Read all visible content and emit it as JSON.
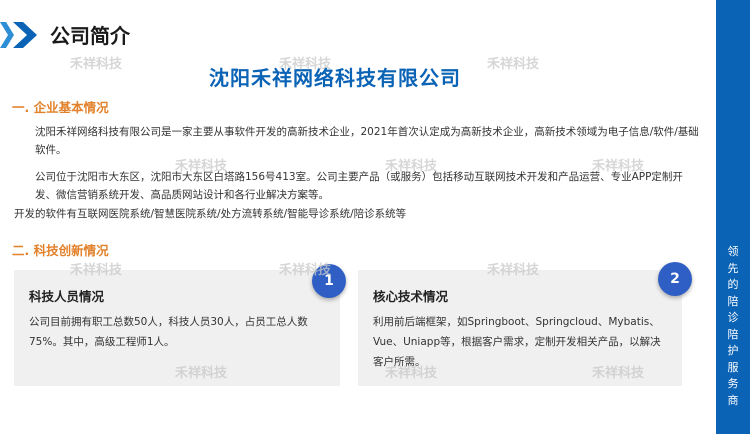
{
  "header": {
    "title": "公司简介"
  },
  "company_name": "沈阳禾祥网络科技有限公司",
  "section1": {
    "heading": "一. 企业基本情况",
    "para1": "沈阳禾祥网络科技有限公司是一家主要从事软件开发的高新技术企业，2021年首次认定成为高新技术企业，高新技术领域为电子信息/软件/基础软件。",
    "para2": "公司位于沈阳市大东区，沈阳市大东区白塔路156号413室。公司主要产品（或服务）包括移动互联网技术开发和产品运营、专业APP定制开发、微信营销系统开发、高品质网站设计和各行业解决方案等。",
    "para3": "开发的软件有互联网医院系统/智慧医院系统/处方流转系统/智能导诊系统/陪诊系统等"
  },
  "section2": {
    "heading": "二. 科技创新情况",
    "card1": {
      "number": "1",
      "title": "科技人员情况",
      "body": "公司目前拥有职工总数50人，科技人员30人，占员工总人数75%。其中，高级工程师1人。"
    },
    "card2": {
      "number": "2",
      "title": "核心技术情况",
      "body": "利用前后端框架，如Springboot、Springcloud、Mybatis、Vue、Uniapp等，根据客户需求，定制开发相关产品，以解决客户所需。"
    }
  },
  "sidebar": {
    "chars": [
      "领",
      "先",
      "的",
      "陪",
      "诊",
      "陪",
      "护",
      "服",
      "务",
      "商"
    ]
  },
  "watermark": "禾祥科技",
  "colors": {
    "brand_blue": "#0b63b6",
    "accent_orange": "#e2812a",
    "badge_blue": "#2f5fc4",
    "card_bg": "#f0f0f0"
  }
}
